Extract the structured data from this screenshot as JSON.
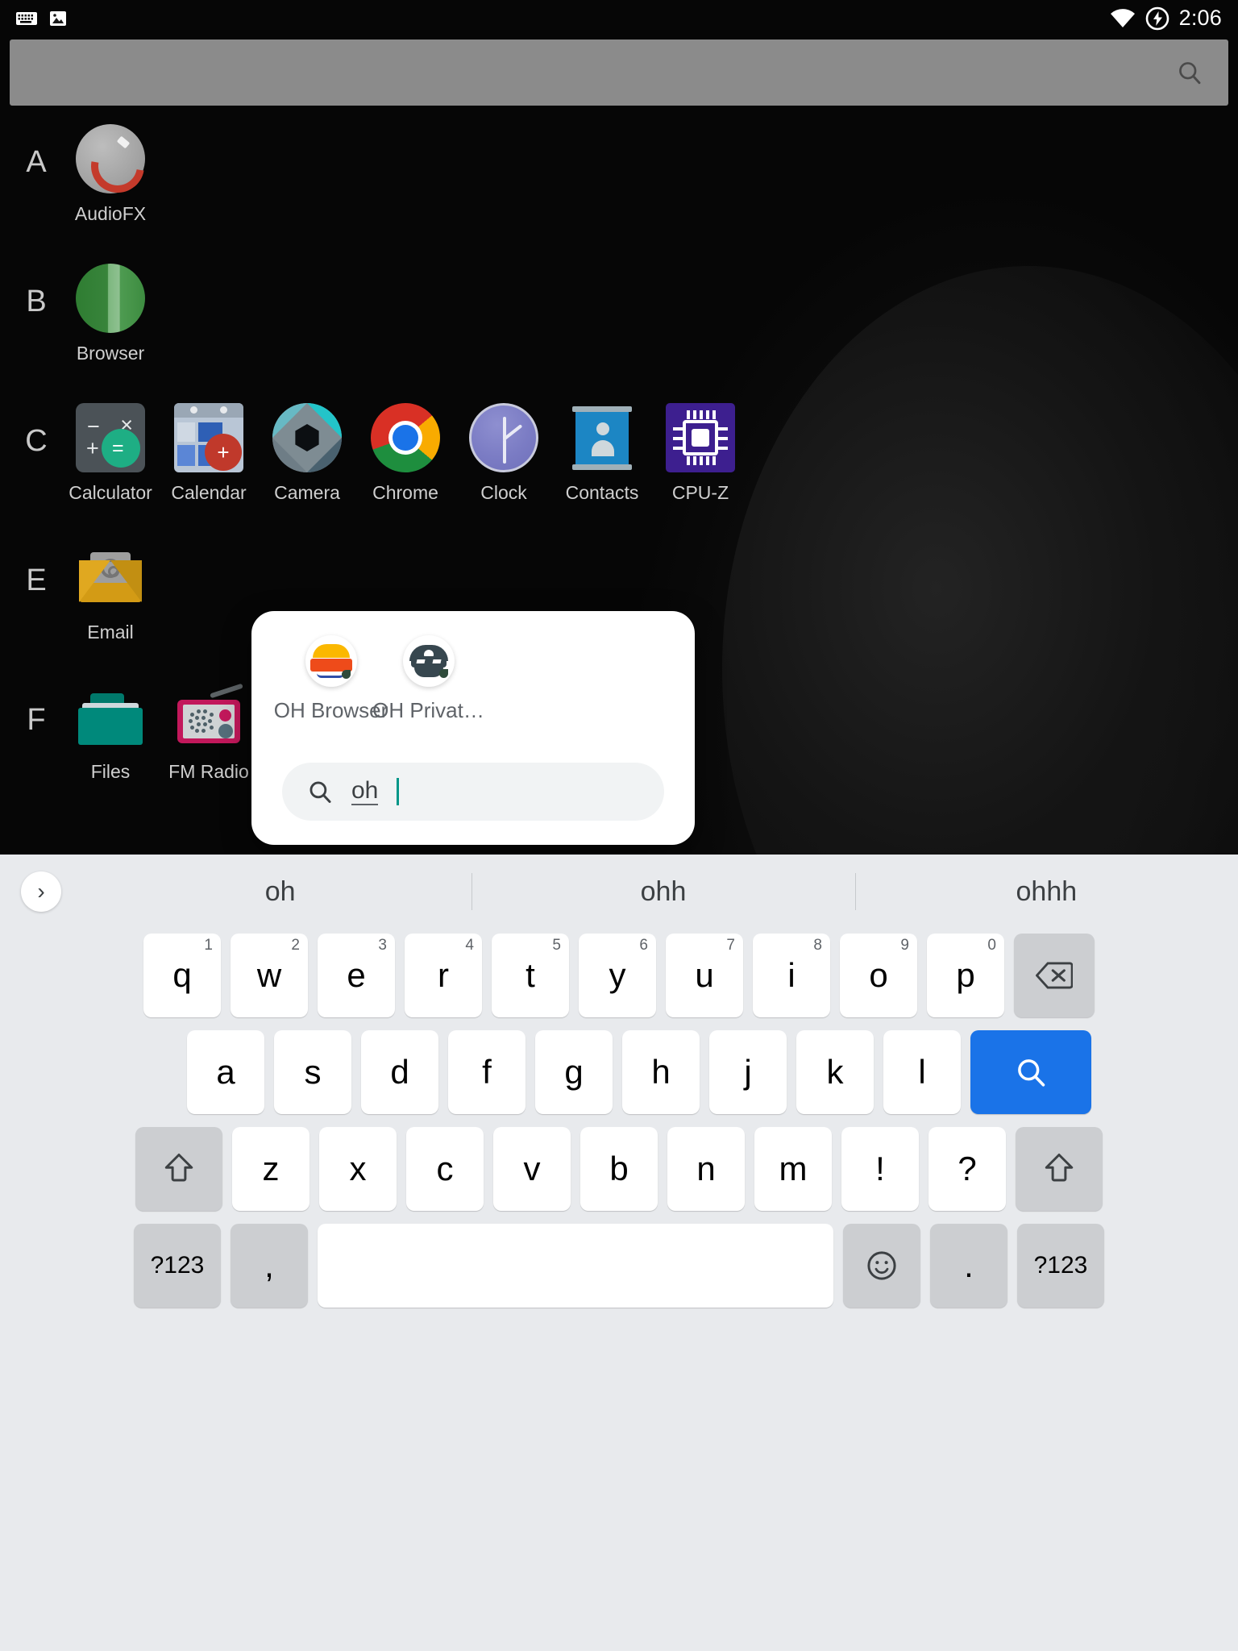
{
  "statusbar": {
    "time": "2:06",
    "icons_left": [
      "keyboard-icon",
      "image-icon"
    ],
    "icons_right": [
      "wifi-icon",
      "charging-bolt-icon"
    ]
  },
  "search_bar": {
    "value": "",
    "placeholder": "",
    "icon": "search-icon"
  },
  "drawer": {
    "rows": [
      {
        "letter": "A",
        "apps": [
          {
            "label": "AudioFX",
            "icon": "audiofx-icon"
          }
        ]
      },
      {
        "letter": "B",
        "apps": [
          {
            "label": "Browser",
            "icon": "browser-icon"
          }
        ]
      },
      {
        "letter": "C",
        "apps": [
          {
            "label": "Calculator",
            "icon": "calculator-icon"
          },
          {
            "label": "Calendar",
            "icon": "calendar-icon"
          },
          {
            "label": "Camera",
            "icon": "camera-icon"
          },
          {
            "label": "Chrome",
            "icon": "chrome-icon"
          },
          {
            "label": "Clock",
            "icon": "clock-icon"
          },
          {
            "label": "Contacts",
            "icon": "contacts-icon"
          },
          {
            "label": "CPU-Z",
            "icon": "cpuz-icon"
          }
        ]
      },
      {
        "letter": "E",
        "apps": [
          {
            "label": "Email",
            "icon": "email-icon"
          }
        ]
      },
      {
        "letter": "F",
        "apps": [
          {
            "label": "Files",
            "icon": "files-icon"
          },
          {
            "label": "FM Radio",
            "icon": "fm-radio-icon"
          }
        ]
      }
    ]
  },
  "popup": {
    "results": [
      {
        "label": "OH Browser",
        "icon": "oh-browser-icon"
      },
      {
        "label": "OH Privat…",
        "icon": "oh-private-browser-icon"
      }
    ],
    "search": {
      "value": "oh",
      "icon": "search-icon"
    }
  },
  "keyboard": {
    "expand_icon": "chevron-right-icon",
    "suggestions": [
      "oh",
      "ohh",
      "ohhh"
    ],
    "row1": [
      {
        "label": "q",
        "num": "1"
      },
      {
        "label": "w",
        "num": "2"
      },
      {
        "label": "e",
        "num": "3"
      },
      {
        "label": "r",
        "num": "4"
      },
      {
        "label": "t",
        "num": "5"
      },
      {
        "label": "y",
        "num": "6"
      },
      {
        "label": "u",
        "num": "7"
      },
      {
        "label": "i",
        "num": "8"
      },
      {
        "label": "o",
        "num": "9"
      },
      {
        "label": "p",
        "num": "0"
      }
    ],
    "backspace": "backspace-icon",
    "row2": [
      "a",
      "s",
      "d",
      "f",
      "g",
      "h",
      "j",
      "k",
      "l"
    ],
    "enter": "search-icon",
    "shift_left": "shift-icon",
    "row3": [
      "z",
      "x",
      "c",
      "v",
      "b",
      "n",
      "m",
      "!",
      "?"
    ],
    "shift_right": "shift-icon",
    "row4": {
      "symbols_left": "?123",
      "comma": ",",
      "space": "",
      "emoji": "emoji-icon",
      "period": ".",
      "symbols_right": "?123"
    }
  }
}
